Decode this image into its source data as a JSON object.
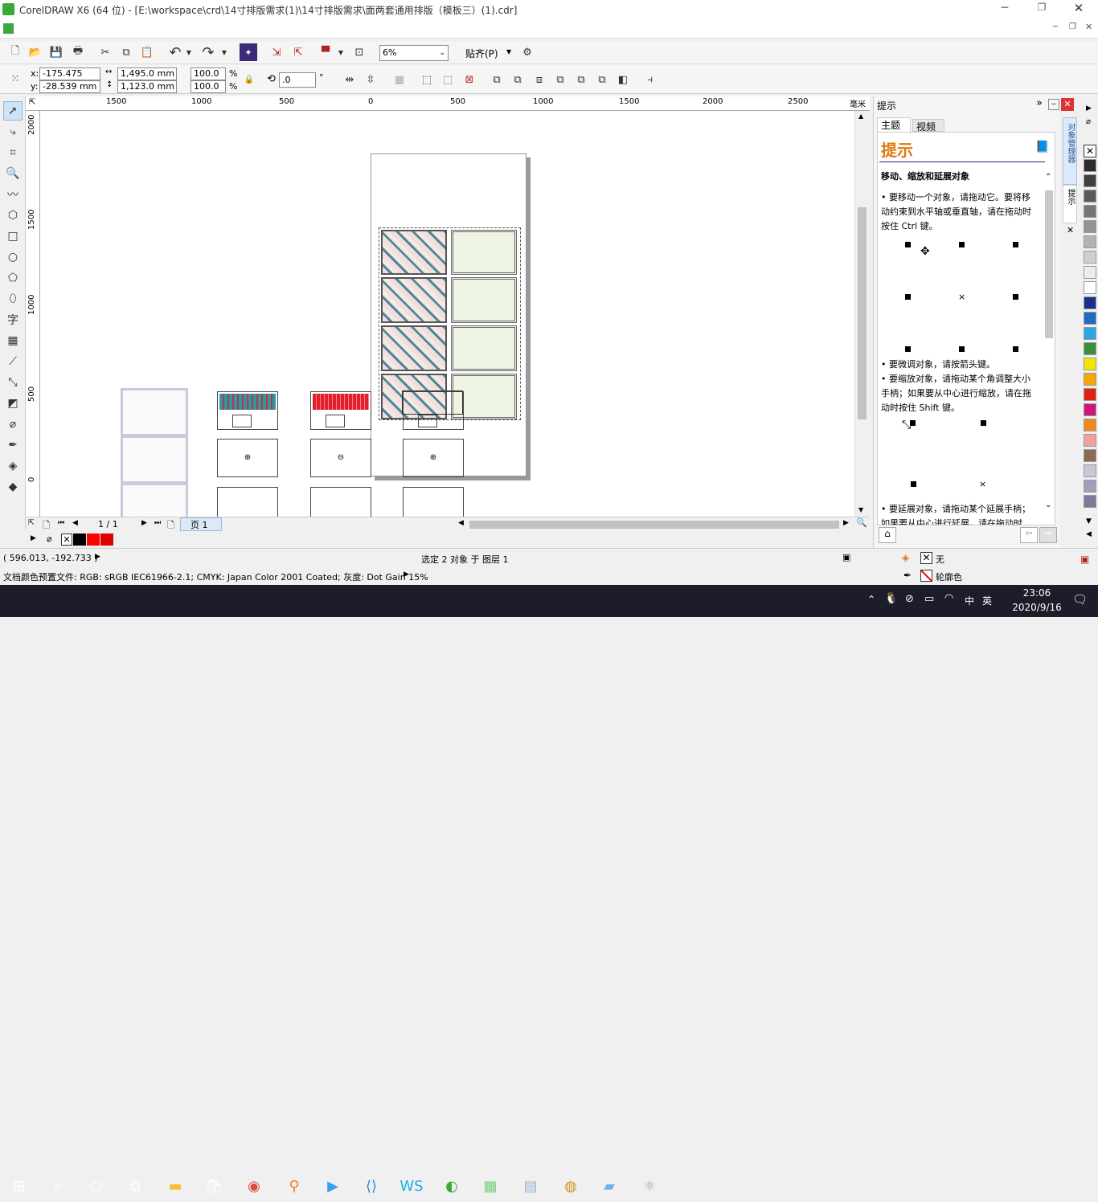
{
  "title_bar": {
    "title": "CorelDRAW X6 (64 位) - [E:\\workspace\\crd\\14寸排版需求(1)\\14寸排版需求\\面两套通用排版（模板三）(1).cdr]"
  },
  "toolbar": {
    "zoom": "6%",
    "snap_label": "贴齐(P)"
  },
  "property_bar": {
    "x": "-175.475 mm",
    "y": "-28.539 mm",
    "width": "1,495.0 mm",
    "height": "1,123.0 mm",
    "scale_x": "100.0",
    "scale_y": "100.0",
    "pct": "%",
    "rotation": ".0",
    "deg": "°"
  },
  "ruler": {
    "h_ticks": [
      "1500",
      "1000",
      "500",
      "0",
      "500",
      "1000",
      "1500",
      "2000",
      "2500"
    ],
    "unit": "毫米",
    "v_ticks": [
      "2000",
      "1500",
      "1000",
      "500",
      "0"
    ]
  },
  "page_nav": {
    "counter": "1 / 1",
    "page_tab": "页 1"
  },
  "docker": {
    "header": "提示",
    "tabs": [
      "主题",
      "视频"
    ],
    "big_title": "提示",
    "section_title": "移动、缩放和延展对象",
    "bullet1": "要移动一个对象，请拖动它。要将移动约束到水平轴或垂直轴，请在拖动时按住 Ctrl 键。",
    "bullet2": "要微调对象，请按箭头键。",
    "bullet3": "要缩放对象，请拖动某个角调整大小手柄；如果要从中心进行缩放，请在拖动时按住 Shift 键。",
    "bullet4": "要延展对象，请拖动某个延展手柄；如果要从中心进行延展，请在拖动时",
    "side_tab1": "对象管理器",
    "side_tab2": "提示"
  },
  "status": {
    "coords": "( 596.013, -192.733 )",
    "selection": "选定 2 对象 于 图层 1",
    "fill_label": "无",
    "outline_label": "轮廓色",
    "color_profile": "文档颜色预置文件: RGB: sRGB IEC61966-2.1; CMYK: Japan Color 2001 Coated; 灰度: Dot Gain 15%"
  },
  "taskbar": {
    "time": "23:06",
    "date": "2020/9/16",
    "ime": "英",
    "ime2": "中"
  },
  "palette": {
    "colors": [
      "#2b2b2b",
      "#3f3f3f",
      "#5a5a5a",
      "#767676",
      "#939393",
      "#b3b3b3",
      "#d0d0d0",
      "#ececec",
      "#ffffff",
      "#1a2f8c",
      "#1e6bc0",
      "#2aa6e0",
      "#3a8e3a",
      "#f5e400",
      "#f5a800",
      "#e02010",
      "#d0157a",
      "#f08a1e",
      "#f0a0a0",
      "#8a6a50",
      "#c7c7d8",
      "#a0a0b8",
      "#7a7a9a"
    ]
  }
}
